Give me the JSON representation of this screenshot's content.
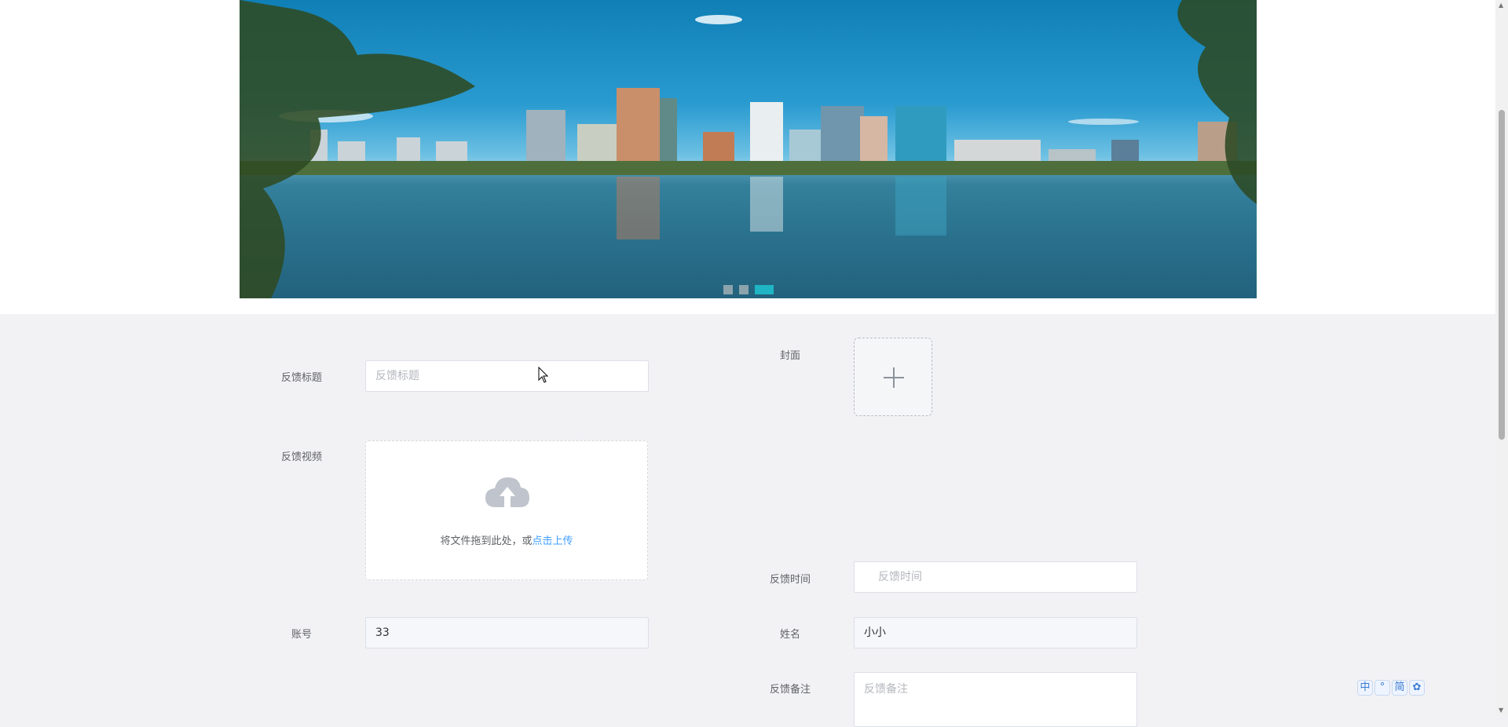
{
  "banner": {
    "carousel": {
      "count": 3,
      "active_index": 2
    }
  },
  "form": {
    "title": {
      "label": "反馈标题",
      "placeholder": "反馈标题"
    },
    "cover": {
      "label": "封面"
    },
    "video": {
      "label": "反馈视频",
      "drag_text": "将文件拖到此处，或",
      "drag_link": "点击上传"
    },
    "time": {
      "label": "反馈时间",
      "placeholder": "反馈时间"
    },
    "account": {
      "label": "账号",
      "value": "33"
    },
    "name": {
      "label": "姓名",
      "value": "小小"
    },
    "remark": {
      "label": "反馈备注",
      "placeholder": "反馈备注"
    }
  },
  "ime_toolbar": {
    "items": [
      "中",
      "°",
      "简",
      "✿"
    ]
  },
  "colors": {
    "accent": "#1fb5c4",
    "link": "#409eff",
    "page_bg": "#f2f2f5"
  }
}
